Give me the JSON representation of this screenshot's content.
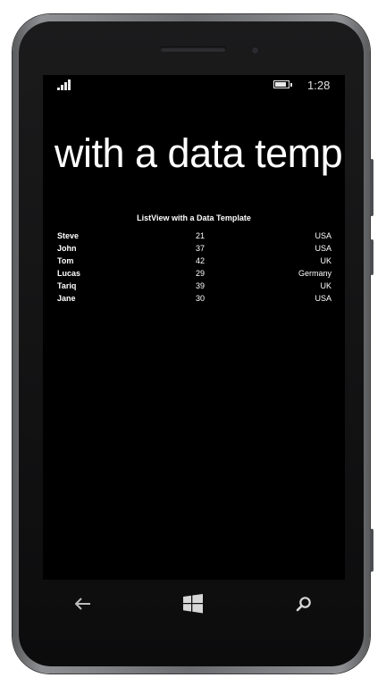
{
  "status_bar": {
    "time": "1:28",
    "signal_icon": "signal-strength-icon",
    "battery_icon": "battery-icon"
  },
  "page": {
    "title": "with a data template"
  },
  "list": {
    "header": "ListView with a Data Template",
    "items": [
      {
        "name": "Steve",
        "age": "21",
        "country": "USA"
      },
      {
        "name": "John",
        "age": "37",
        "country": "USA"
      },
      {
        "name": "Tom",
        "age": "42",
        "country": "UK"
      },
      {
        "name": "Lucas",
        "age": "29",
        "country": "Germany"
      },
      {
        "name": "Tariq",
        "age": "39",
        "country": "UK"
      },
      {
        "name": "Jane",
        "age": "30",
        "country": "USA"
      }
    ]
  },
  "navbar": {
    "back_icon": "back-arrow-icon",
    "start_icon": "windows-logo-icon",
    "search_icon": "search-icon"
  },
  "colors": {
    "screen_background": "#000000",
    "text": "#ffffff"
  }
}
